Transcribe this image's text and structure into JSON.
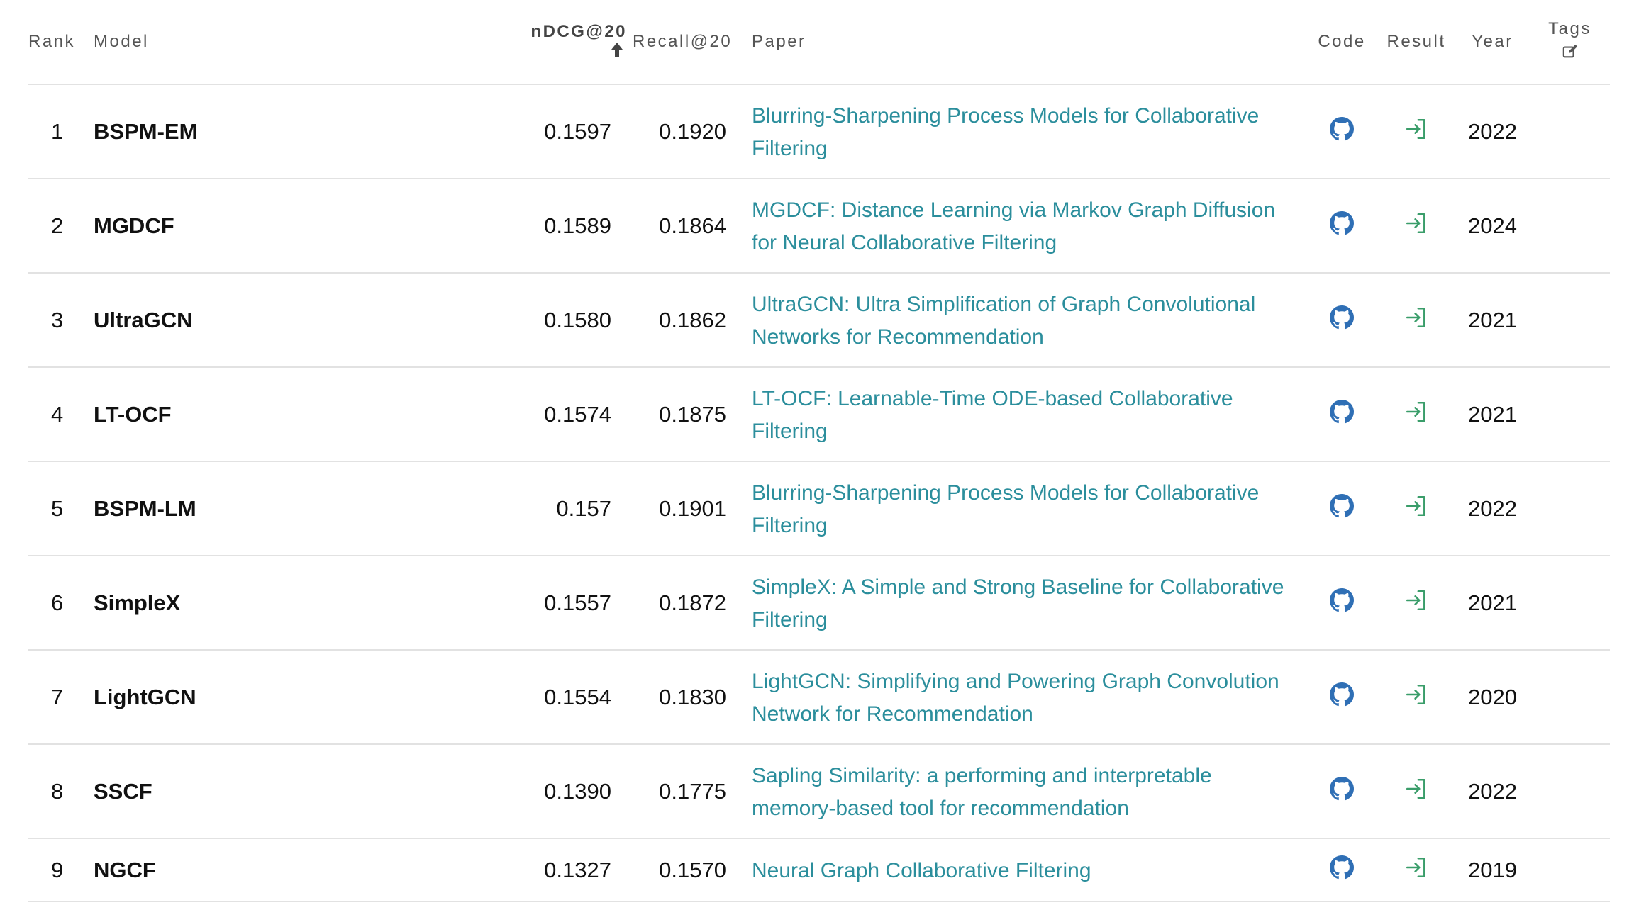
{
  "columns": {
    "rank": "Rank",
    "model": "Model",
    "ndcg": "nDCG@20",
    "recall": "Recall@20",
    "paper": "Paper",
    "code": "Code",
    "result": "Result",
    "year": "Year",
    "tags": "Tags"
  },
  "colors": {
    "link": "#2b8e9c",
    "code_icon": "#2f6fb5",
    "result_icon": "#3a9d6a"
  },
  "rows": [
    {
      "rank": "1",
      "model": "BSPM-EM",
      "ndcg": "0.1597",
      "recall": "0.1920",
      "paper": "Blurring-Sharpening Process Models for Collaborative Filtering",
      "year": "2022"
    },
    {
      "rank": "2",
      "model": "MGDCF",
      "ndcg": "0.1589",
      "recall": "0.1864",
      "paper": "MGDCF: Distance Learning via Markov Graph Diffusion for Neural Collaborative Filtering",
      "year": "2024"
    },
    {
      "rank": "3",
      "model": "UltraGCN",
      "ndcg": "0.1580",
      "recall": "0.1862",
      "paper": "UltraGCN: Ultra Simplification of Graph Convolutional Networks for Recommendation",
      "year": "2021"
    },
    {
      "rank": "4",
      "model": "LT-OCF",
      "ndcg": "0.1574",
      "recall": "0.1875",
      "paper": "LT-OCF: Learnable-Time ODE-based Collaborative Filtering",
      "year": "2021"
    },
    {
      "rank": "5",
      "model": "BSPM-LM",
      "ndcg": "0.157",
      "recall": "0.1901",
      "paper": "Blurring-Sharpening Process Models for Collaborative Filtering",
      "year": "2022"
    },
    {
      "rank": "6",
      "model": "SimpleX",
      "ndcg": "0.1557",
      "recall": "0.1872",
      "paper": "SimpleX: A Simple and Strong Baseline for Collaborative Filtering",
      "year": "2021"
    },
    {
      "rank": "7",
      "model": "LightGCN",
      "ndcg": "0.1554",
      "recall": "0.1830",
      "paper": "LightGCN: Simplifying and Powering Graph Convolution Network for Recommendation",
      "year": "2020"
    },
    {
      "rank": "8",
      "model": "SSCF",
      "ndcg": "0.1390",
      "recall": "0.1775",
      "paper": "Sapling Similarity: a performing and interpretable memory-based tool for recommendation",
      "year": "2022"
    },
    {
      "rank": "9",
      "model": "NGCF",
      "ndcg": "0.1327",
      "recall": "0.1570",
      "paper": "Neural Graph Collaborative Filtering",
      "year": "2019"
    }
  ]
}
